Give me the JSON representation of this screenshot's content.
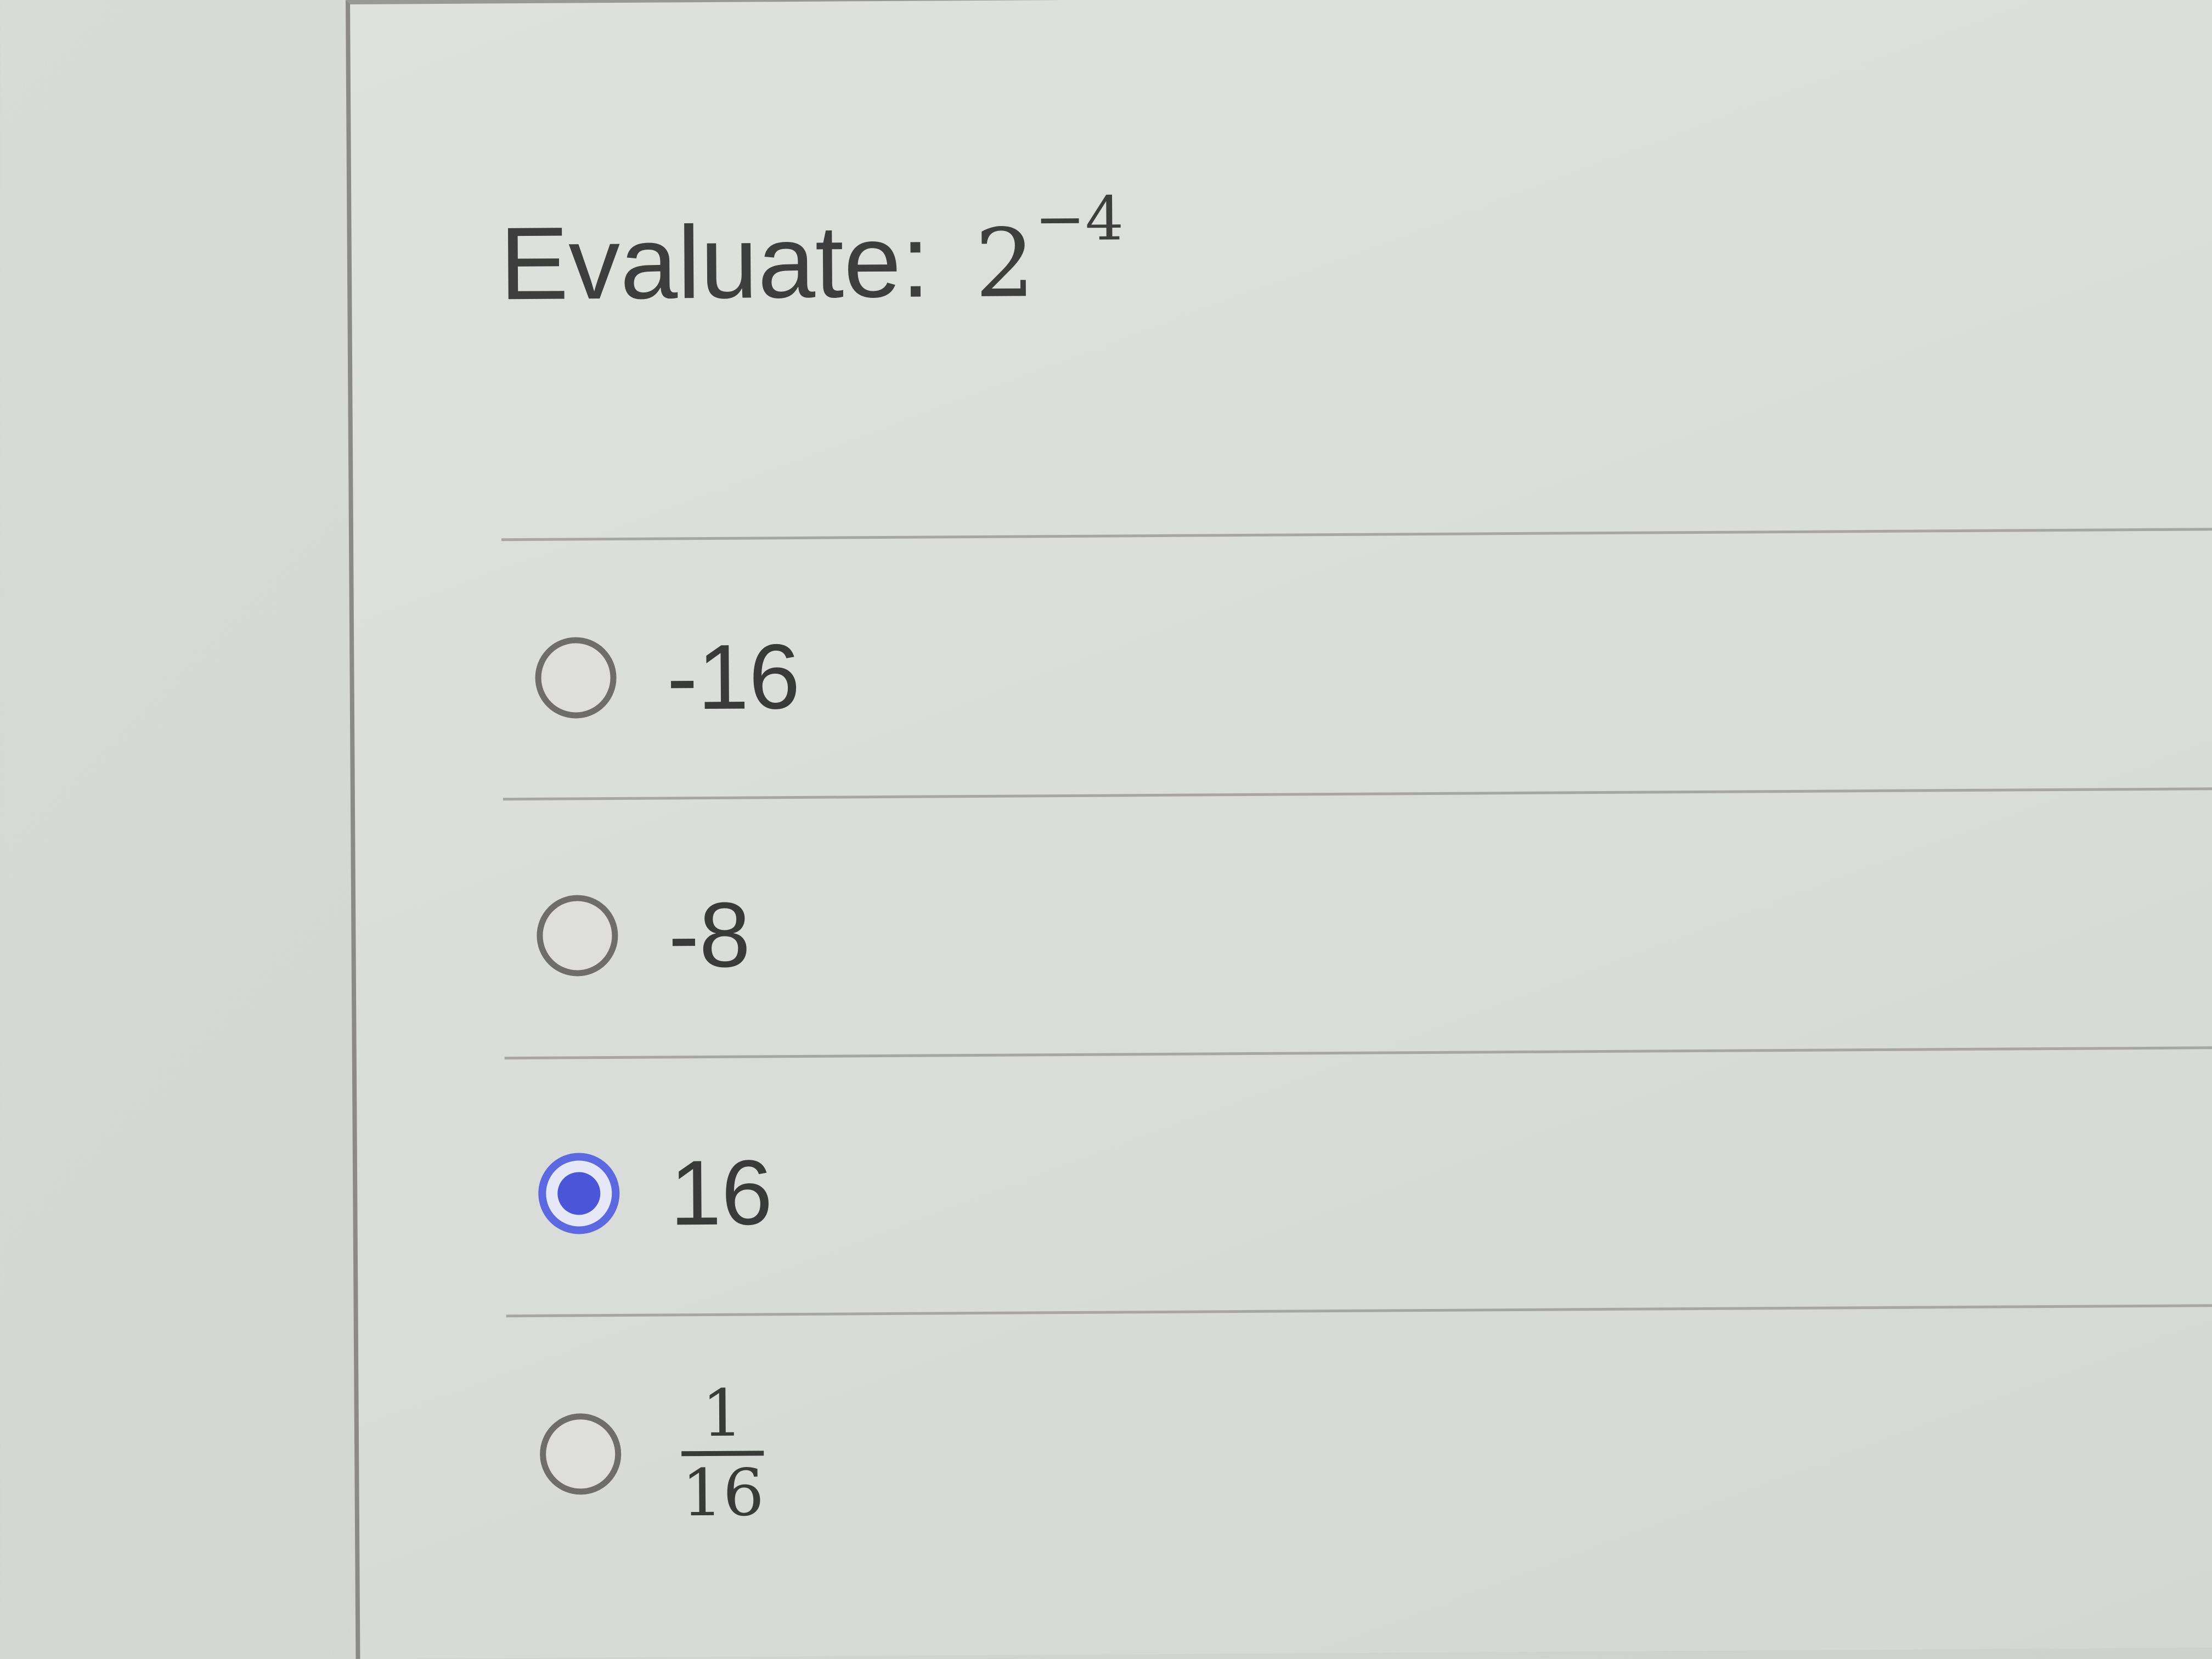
{
  "question": {
    "prompt": "Evaluate:",
    "base": "2",
    "exponent": "−4"
  },
  "options": [
    {
      "label": "-16",
      "selected": false
    },
    {
      "label": "-8",
      "selected": false
    },
    {
      "label": "16",
      "selected": true
    },
    {
      "numerator": "1",
      "denominator": "16",
      "selected": false
    }
  ],
  "colors": {
    "accent": "#4b55d8",
    "radio_border": "#6f6c6c",
    "text": "#3a3a3a",
    "divider": "#a8a6a4"
  }
}
